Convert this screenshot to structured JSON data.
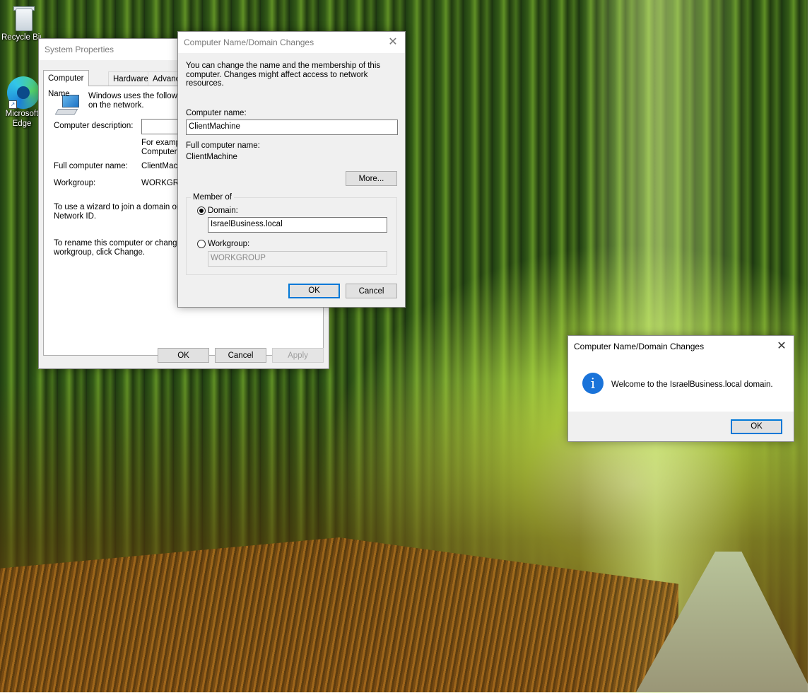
{
  "desktop": {
    "icons": [
      {
        "label": "Recycle Bin",
        "icon": "recycle-bin-icon"
      },
      {
        "label": "Microsoft Edge",
        "icon": "edge-icon"
      }
    ]
  },
  "system_properties": {
    "title": "System Properties",
    "tabs": [
      "Computer Name",
      "Hardware",
      "Advanced"
    ],
    "description_text_1": "Windows uses the following information to identify your computer",
    "description_text_2": "on the network.",
    "computer_description_label": "Computer description:",
    "computer_description_value": "",
    "example_line_1": "For example: \"Kitchen Computer\" or \"Mary's",
    "example_line_2": "Computer\".",
    "full_name_label": "Full computer name:",
    "full_name_value": "ClientMachine",
    "workgroup_label": "Workgroup:",
    "workgroup_value": "WORKGROUP",
    "network_id_line_1": "To use a wizard to join a domain or workgroup, click",
    "network_id_line_2": "Network ID.",
    "rename_line_1": "To rename this computer or change its domain or",
    "rename_line_2": "workgroup, click Change.",
    "ok": "OK",
    "cancel": "Cancel",
    "apply": "Apply"
  },
  "name_changes": {
    "title": "Computer Name/Domain Changes",
    "intro_line_1": "You can change the name and the membership of this",
    "intro_line_2": "computer. Changes might affect access to network resources.",
    "computer_name_label": "Computer name:",
    "computer_name_value": "ClientMachine",
    "full_name_label": "Full computer name:",
    "full_name_value": "ClientMachine",
    "more": "More...",
    "member_of": "Member of",
    "domain_label": "Domain:",
    "domain_value": "IsraelBusiness.local",
    "workgroup_label": "Workgroup:",
    "workgroup_value": "WORKGROUP",
    "ok": "OK",
    "cancel": "Cancel"
  },
  "welcome_dialog": {
    "title": "Computer Name/Domain Changes",
    "message": "Welcome to the IsraelBusiness.local domain.",
    "ok": "OK",
    "icon": "info-icon"
  },
  "colors": {
    "accent": "#0078d7",
    "info": "#1a73d9"
  }
}
